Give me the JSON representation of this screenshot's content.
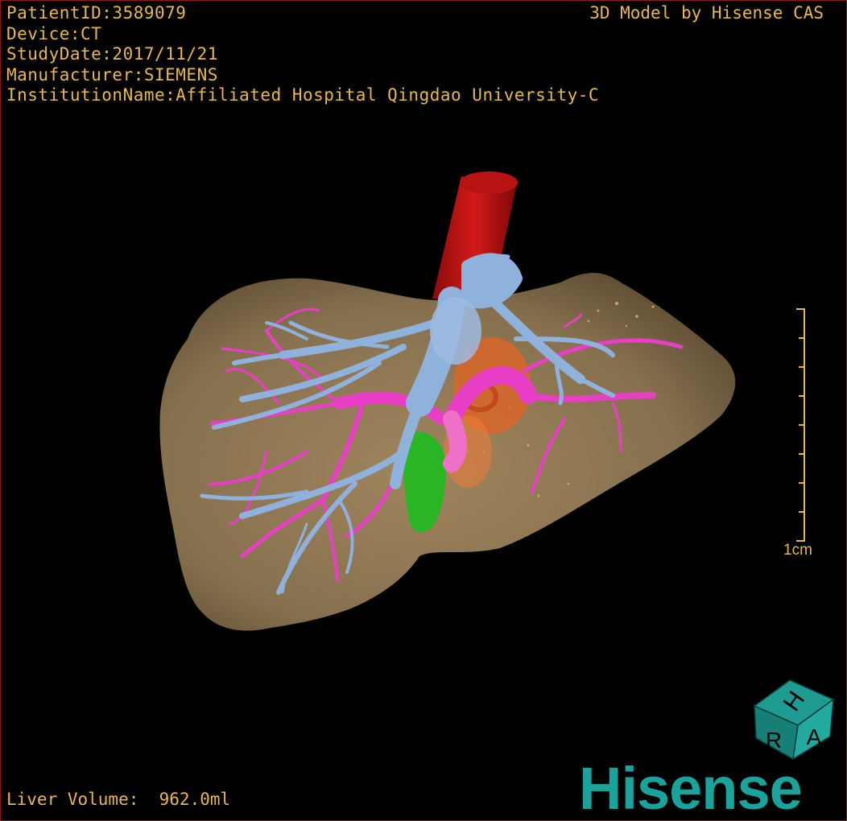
{
  "patient_info": [
    "PatientID:3589079",
    "Device:CT",
    "StudyDate:2017/11/21",
    "Manufacturer:SIEMENS",
    "InstitutionName:Affiliated Hospital Qingdao University-C"
  ],
  "brand_text": "3D Model by Hisense CAS",
  "liver_volume": "Liver Volume:  962.0ml",
  "scale_label": "1cm",
  "orientation_cube": {
    "top": "H",
    "left": "R",
    "right": "A"
  },
  "logo_text": "Hisense",
  "colors": {
    "text": "#e8b84a",
    "liver": "#8b7250",
    "artery": "#cc1111",
    "hepatic_vein": "#8fb2dc",
    "portal_vein": "#e83fc6",
    "gallbladder": "#29b524",
    "tumor": "#e8631f",
    "logo": "#1aa39d"
  }
}
